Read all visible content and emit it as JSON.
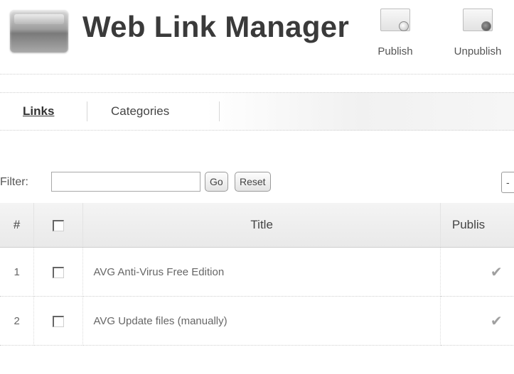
{
  "header": {
    "title": "Web Link Manager",
    "logo_icon": "weblinks-logo-icon",
    "toolbar": [
      {
        "label": "Publish",
        "icon": "publish-icon"
      },
      {
        "label": "Unpublish",
        "icon": "unpublish-icon"
      }
    ]
  },
  "submenu": {
    "tabs": [
      {
        "label": "Links",
        "active": true
      },
      {
        "label": "Categories",
        "active": false
      }
    ]
  },
  "filter": {
    "label": "Filter:",
    "value": "",
    "placeholder": "",
    "go_label": "Go",
    "reset_label": "Reset",
    "state_select": "-"
  },
  "table": {
    "headers": {
      "num": "#",
      "title": "Title",
      "published": "Publis"
    },
    "rows": [
      {
        "num": "1",
        "title": "AVG Anti-Virus Free Edition",
        "published_icon": "tick-icon",
        "published_glyph": "✔"
      },
      {
        "num": "2",
        "title": "AVG Update files (manually)",
        "published_icon": "tick-icon",
        "published_glyph": "✔"
      }
    ]
  }
}
